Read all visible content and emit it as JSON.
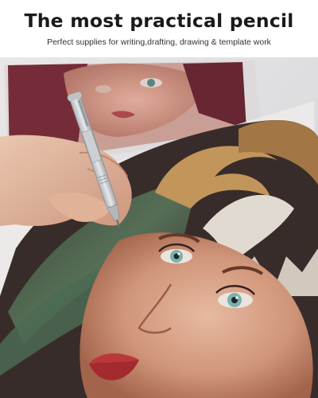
{
  "header": {
    "title": "The most practical pencil",
    "subtitle": "Perfect supplies for writing,drafting, drawing & template work"
  },
  "photo": {
    "subject": "hand-drawing-pencil-portrait-icon"
  },
  "colors": {
    "title": "#1a1a1a",
    "subtitle": "#333333",
    "background": "#ffffff",
    "pencil_body": "#d9dde0",
    "skin": "#e6b79f",
    "lips": "#c23a3a",
    "eyes": "#7fb8b0"
  }
}
